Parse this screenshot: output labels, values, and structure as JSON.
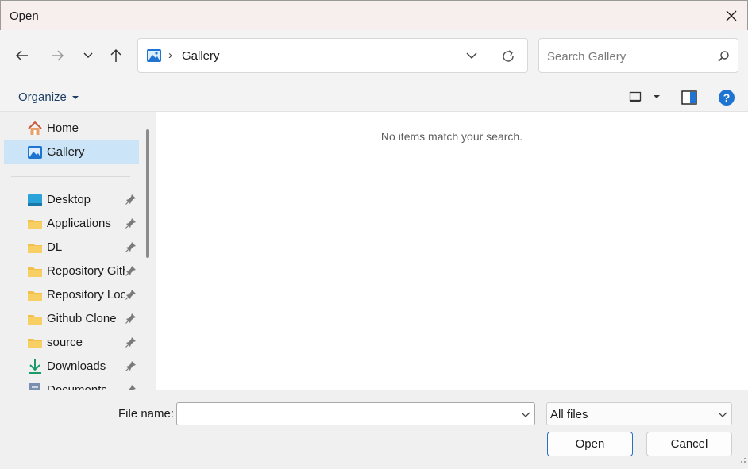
{
  "window": {
    "title": "Open"
  },
  "address": {
    "current": "Gallery",
    "separator": "›"
  },
  "search": {
    "placeholder": "Search Gallery"
  },
  "commandbar": {
    "organize_label": "Organize"
  },
  "sidebar": {
    "quick": [
      {
        "label": "Home",
        "icon": "home-icon"
      },
      {
        "label": "Gallery",
        "icon": "gallery-icon",
        "selected": true
      }
    ],
    "pinned": [
      {
        "label": "Desktop",
        "icon": "desktop-icon"
      },
      {
        "label": "Applications",
        "icon": "folder-icon"
      },
      {
        "label": "DL",
        "icon": "folder-icon"
      },
      {
        "label": "Repository Github",
        "icon": "folder-icon"
      },
      {
        "label": "Repository Local",
        "icon": "folder-icon"
      },
      {
        "label": "Github Clone",
        "icon": "folder-icon"
      },
      {
        "label": "source",
        "icon": "folder-icon"
      },
      {
        "label": "Downloads",
        "icon": "download-icon"
      },
      {
        "label": "Documents",
        "icon": "documents-icon"
      }
    ]
  },
  "content": {
    "empty_message": "No items match your search."
  },
  "footer": {
    "filename_label": "File name:",
    "filename_value": "",
    "filter_value": "All files",
    "open_label": "Open",
    "cancel_label": "Cancel"
  },
  "colors": {
    "accent": "#1e74d0",
    "selection": "#cce4f7",
    "folder": "#f3c04d"
  }
}
